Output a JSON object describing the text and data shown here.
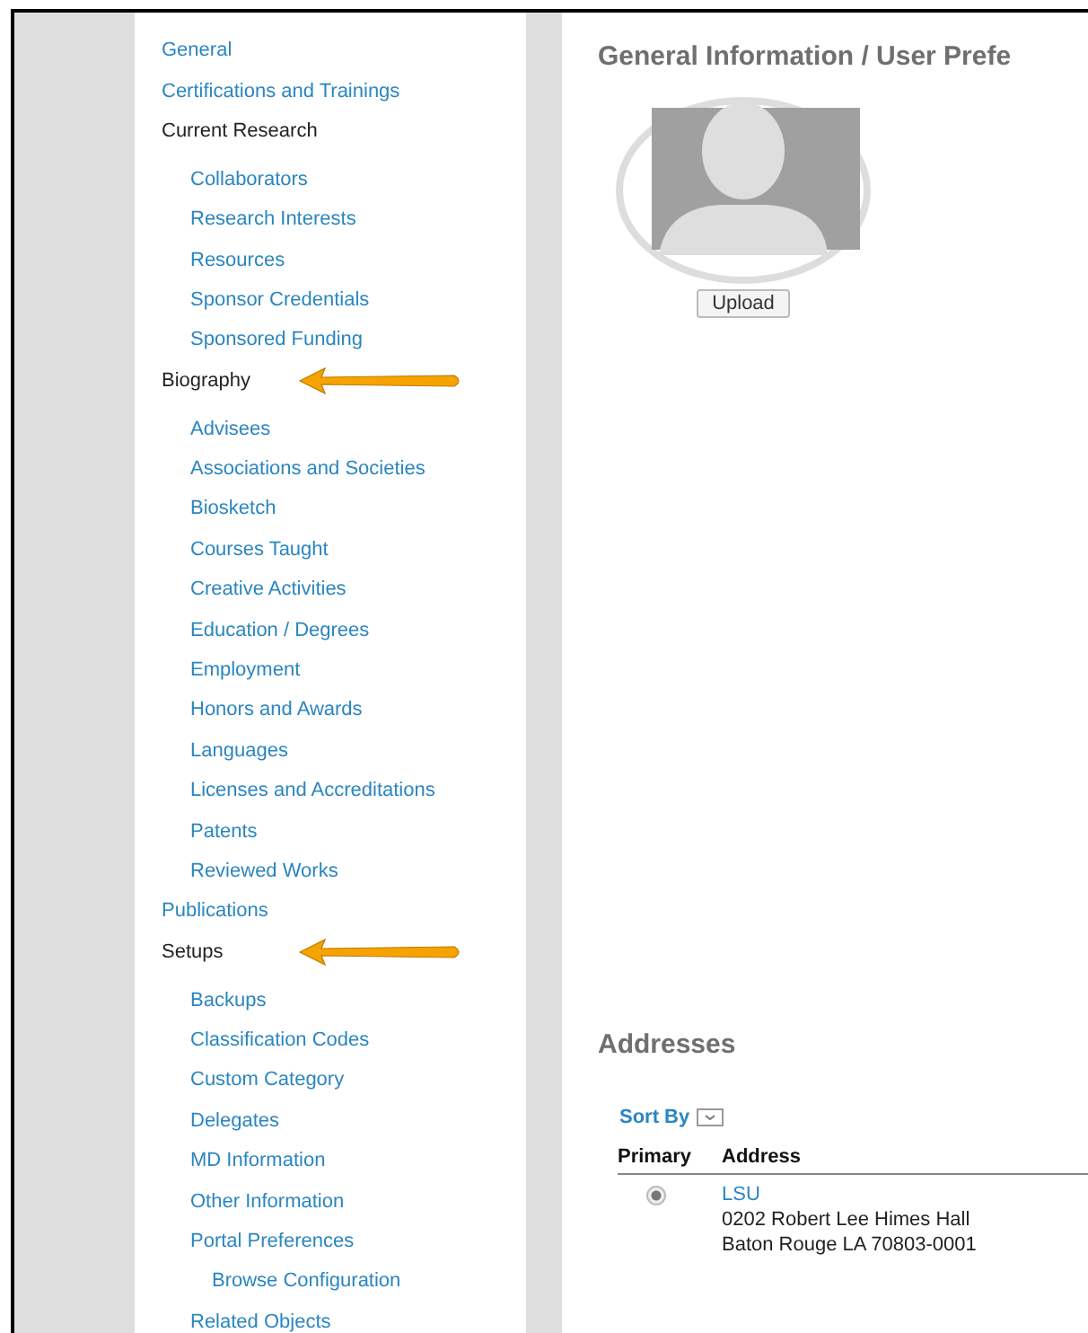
{
  "sidebar": {
    "items": [
      {
        "label": "General",
        "kind": "link"
      },
      {
        "label": "Certifications and Trainings",
        "kind": "link"
      },
      {
        "label": "Current Research",
        "kind": "heading",
        "children": [
          {
            "label": "Collaborators",
            "kind": "link"
          },
          {
            "label": "Research Interests",
            "kind": "link"
          },
          {
            "label": "Resources",
            "kind": "link"
          },
          {
            "label": "Sponsor Credentials",
            "kind": "link"
          },
          {
            "label": "Sponsored Funding",
            "kind": "link"
          }
        ]
      },
      {
        "label": "Biography",
        "kind": "heading",
        "pointed": true,
        "children": [
          {
            "label": "Advisees",
            "kind": "link"
          },
          {
            "label": "Associations and Societies",
            "kind": "link"
          },
          {
            "label": "Biosketch",
            "kind": "link"
          },
          {
            "label": "Courses Taught",
            "kind": "link"
          },
          {
            "label": "Creative Activities",
            "kind": "link"
          },
          {
            "label": "Education / Degrees",
            "kind": "link"
          },
          {
            "label": "Employment",
            "kind": "link"
          },
          {
            "label": "Honors and Awards",
            "kind": "link"
          },
          {
            "label": "Languages",
            "kind": "link"
          },
          {
            "label": "Licenses and Accreditations",
            "kind": "link"
          },
          {
            "label": "Patents",
            "kind": "link"
          },
          {
            "label": "Reviewed Works",
            "kind": "link"
          }
        ]
      },
      {
        "label": "Publications",
        "kind": "link"
      },
      {
        "label": "Setups",
        "kind": "heading",
        "pointed": true,
        "children": [
          {
            "label": "Backups",
            "kind": "link"
          },
          {
            "label": "Classification Codes",
            "kind": "link"
          },
          {
            "label": "Custom Category",
            "kind": "link"
          },
          {
            "label": "Delegates",
            "kind": "link"
          },
          {
            "label": "MD Information",
            "kind": "link"
          },
          {
            "label": "Other Information",
            "kind": "link"
          },
          {
            "label": "Portal Preferences",
            "kind": "link",
            "children": [
              {
                "label": "Browse Configuration",
                "kind": "link"
              }
            ]
          },
          {
            "label": "Related Objects",
            "kind": "link"
          }
        ]
      }
    ]
  },
  "main": {
    "title": "General Information / User Prefe",
    "upload_button": "Upload",
    "addresses": {
      "heading": "Addresses",
      "sort_by": "Sort By",
      "columns": [
        "Primary",
        "Address"
      ],
      "rows": [
        {
          "selected": true,
          "name": "LSU",
          "lines": [
            "0202 Robert Lee Himes Hall",
            "Baton Rouge LA 70803-0001"
          ]
        }
      ]
    }
  }
}
